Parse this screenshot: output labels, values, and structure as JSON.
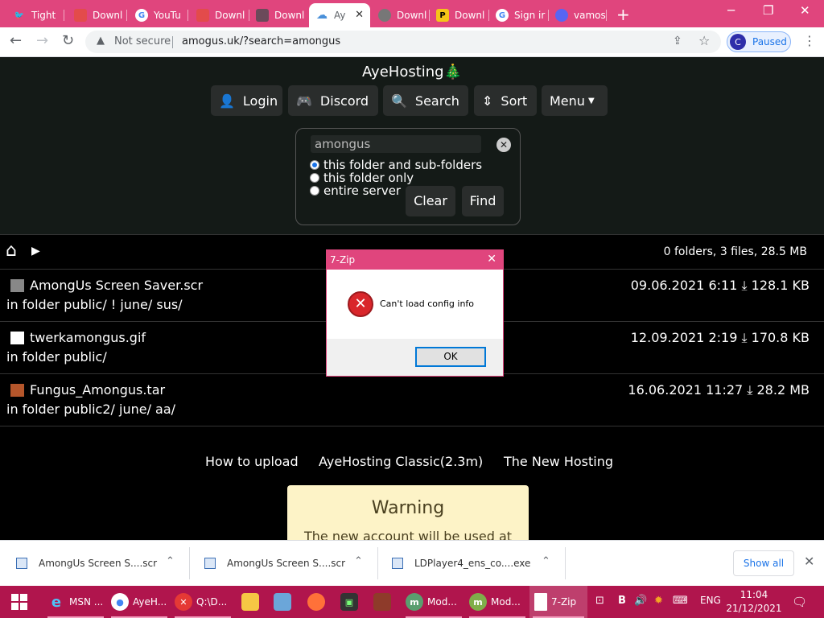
{
  "browser": {
    "tabs": [
      {
        "label": "Tight",
        "icon": "twitter-icon",
        "color": "#1d9bf0"
      },
      {
        "label": "Downl",
        "icon": "download-site-icon",
        "color": "#e34b4b"
      },
      {
        "label": "YouTu",
        "icon": "google-icon",
        "color": "#ffffff"
      },
      {
        "label": "Downl",
        "icon": "download-site-icon",
        "color": "#e34b4b"
      },
      {
        "label": "Downl",
        "icon": "avatar-site-icon",
        "color": "#6b4a5a"
      },
      {
        "label": "Ay",
        "icon": "cloud-icon",
        "color": "#4a90d9"
      },
      {
        "label": "Downl",
        "icon": "globe-icon",
        "color": "#888888"
      },
      {
        "label": "Downl",
        "icon": "pin-site-icon",
        "color": "#f5c518"
      },
      {
        "label": "Sign ir",
        "icon": "google-icon",
        "color": "#ffffff"
      },
      {
        "label": "vamos",
        "icon": "discord-icon",
        "color": "#5865f2"
      }
    ],
    "address": {
      "security": "Not secure",
      "url": "amogus.uk/?search=amongus"
    },
    "profile": {
      "initial": "C",
      "status": "Paused"
    }
  },
  "site": {
    "title": "AyeHosting🎄",
    "nav": {
      "login": "Login",
      "discord": "Discord",
      "search": "Search",
      "sort": "Sort",
      "menu": "Menu"
    },
    "search": {
      "query": "amongus",
      "options": [
        "this folder and sub-folders",
        "this folder only",
        "entire server"
      ],
      "selected": 0,
      "clear": "Clear",
      "find": "Find"
    },
    "summary": "0 folders, 3 files, 28.5 MB",
    "files": [
      {
        "name": "AmongUs Screen Saver.scr",
        "folder": "in folder  public/ ! june/ sus/",
        "date": "09.06.2021 6:11",
        "size": "128.1 KB"
      },
      {
        "name": "twerkamongus.gif",
        "folder": "in folder  public/",
        "date": "12.09.2021 2:19",
        "size": "170.8 KB"
      },
      {
        "name": "Fungus_Amongus.tar",
        "folder": "in folder  public2/ june/ aa/",
        "date": "16.06.2021 11:27",
        "size": "28.2 MB"
      }
    ],
    "footer_links": [
      "How to upload",
      "AyeHosting Classic(2.3m)",
      "The New Hosting"
    ],
    "warning": {
      "title": "Warning",
      "body": "The new account will be used at"
    }
  },
  "dialog": {
    "title": "7-Zip",
    "message": "Can't load config info",
    "ok": "OK"
  },
  "downloads": {
    "items": [
      "AmongUs Screen S....scr",
      "AmongUs Screen S....scr",
      "LDPlayer4_ens_co....exe"
    ],
    "show_all": "Show all"
  },
  "taskbar": {
    "apps": [
      {
        "label": "MSN ...",
        "icon": "ie-icon"
      },
      {
        "label": "AyeH...",
        "icon": "chrome-icon"
      },
      {
        "label": "Q:\\D...",
        "icon": "7zip-icon"
      },
      {
        "label": "",
        "icon": "folder-icon"
      },
      {
        "label": "",
        "icon": "control-panel-icon"
      },
      {
        "label": "",
        "icon": "firefox-icon"
      },
      {
        "label": "",
        "icon": "terminal-icon"
      },
      {
        "label": "",
        "icon": "winrar-icon"
      },
      {
        "label": "Mod...",
        "icon": "m-app-icon"
      },
      {
        "label": "Mod...",
        "icon": "m-app-icon"
      },
      {
        "label": "7-Zip",
        "icon": "document-icon"
      }
    ],
    "tray": {
      "lang": "ENG",
      "keyboard": "B"
    },
    "time": "11:04",
    "date": "21/12/2021"
  }
}
